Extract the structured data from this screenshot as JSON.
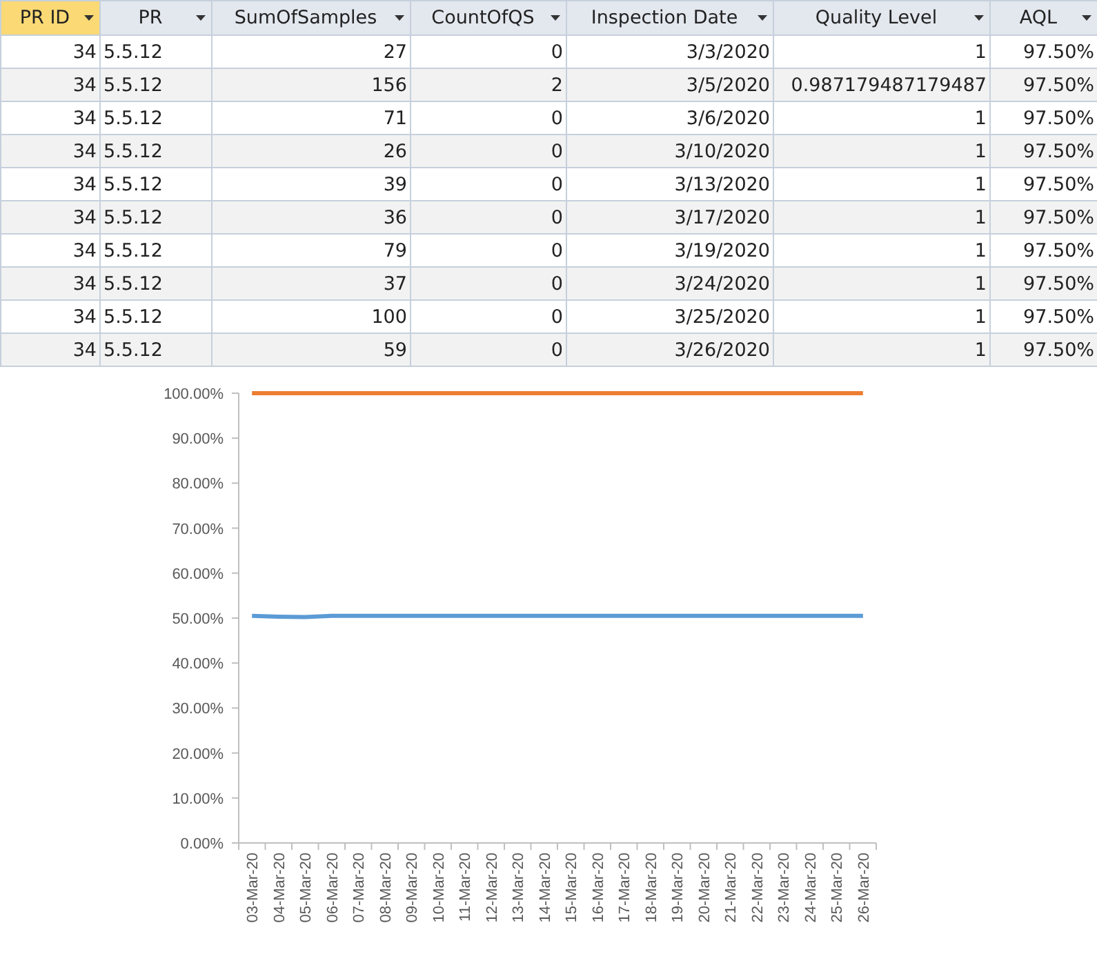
{
  "table": {
    "columns": [
      {
        "label": "PR ID",
        "selected": true
      },
      {
        "label": "PR",
        "selected": false
      },
      {
        "label": "SumOfSamples",
        "selected": false
      },
      {
        "label": "CountOfQS",
        "selected": false
      },
      {
        "label": "Inspection Date",
        "selected": false
      },
      {
        "label": "Quality Level",
        "selected": false
      },
      {
        "label": "AQL",
        "selected": false
      }
    ],
    "rows": [
      [
        "34",
        "5.5.12",
        "27",
        "0",
        "3/3/2020",
        "1",
        "97.50%"
      ],
      [
        "34",
        "5.5.12",
        "156",
        "2",
        "3/5/2020",
        "0.987179487179487",
        "97.50%"
      ],
      [
        "34",
        "5.5.12",
        "71",
        "0",
        "3/6/2020",
        "1",
        "97.50%"
      ],
      [
        "34",
        "5.5.12",
        "26",
        "0",
        "3/10/2020",
        "1",
        "97.50%"
      ],
      [
        "34",
        "5.5.12",
        "39",
        "0",
        "3/13/2020",
        "1",
        "97.50%"
      ],
      [
        "34",
        "5.5.12",
        "36",
        "0",
        "3/17/2020",
        "1",
        "97.50%"
      ],
      [
        "34",
        "5.5.12",
        "79",
        "0",
        "3/19/2020",
        "1",
        "97.50%"
      ],
      [
        "34",
        "5.5.12",
        "37",
        "0",
        "3/24/2020",
        "1",
        "97.50%"
      ],
      [
        "34",
        "5.5.12",
        "100",
        "0",
        "3/25/2020",
        "1",
        "97.50%"
      ],
      [
        "34",
        "5.5.12",
        "59",
        "0",
        "3/26/2020",
        "1",
        "97.50%"
      ]
    ]
  },
  "chart": {
    "chart_data": {
      "type": "line",
      "categories": [
        "03-Mar-20",
        "04-Mar-20",
        "05-Mar-20",
        "06-Mar-20",
        "07-Mar-20",
        "08-Mar-20",
        "09-Mar-20",
        "10-Mar-20",
        "11-Mar-20",
        "12-Mar-20",
        "13-Mar-20",
        "14-Mar-20",
        "15-Mar-20",
        "16-Mar-20",
        "17-Mar-20",
        "18-Mar-20",
        "19-Mar-20",
        "20-Mar-20",
        "21-Mar-20",
        "22-Mar-20",
        "23-Mar-20",
        "24-Mar-20",
        "25-Mar-20",
        "26-Mar-20"
      ],
      "series": [
        {
          "color": "#ed7d31",
          "values": [
            100,
            100,
            100,
            100,
            100,
            100,
            100,
            100,
            100,
            100,
            100,
            100,
            100,
            100,
            100,
            100,
            100,
            100,
            100,
            100,
            100,
            100,
            100,
            100
          ]
        },
        {
          "color": "#5b9bd5",
          "values": [
            50.5,
            50.3,
            50.2,
            50.5,
            50.5,
            50.5,
            50.5,
            50.5,
            50.5,
            50.5,
            50.5,
            50.5,
            50.5,
            50.5,
            50.5,
            50.5,
            50.5,
            50.5,
            50.5,
            50.5,
            50.5,
            50.5,
            50.5,
            50.5
          ]
        }
      ],
      "ylim": [
        0,
        100
      ],
      "yticks": [
        {
          "value": 0,
          "label": "0.00%"
        },
        {
          "value": 10,
          "label": "10.00%"
        },
        {
          "value": 20,
          "label": "20.00%"
        },
        {
          "value": 30,
          "label": "30.00%"
        },
        {
          "value": 40,
          "label": "40.00%"
        },
        {
          "value": 50,
          "label": "50.00%"
        },
        {
          "value": 60,
          "label": "60.00%"
        },
        {
          "value": 70,
          "label": "70.00%"
        },
        {
          "value": 80,
          "label": "80.00%"
        },
        {
          "value": 90,
          "label": "90.00%"
        },
        {
          "value": 100,
          "label": "100.00%"
        }
      ]
    }
  }
}
